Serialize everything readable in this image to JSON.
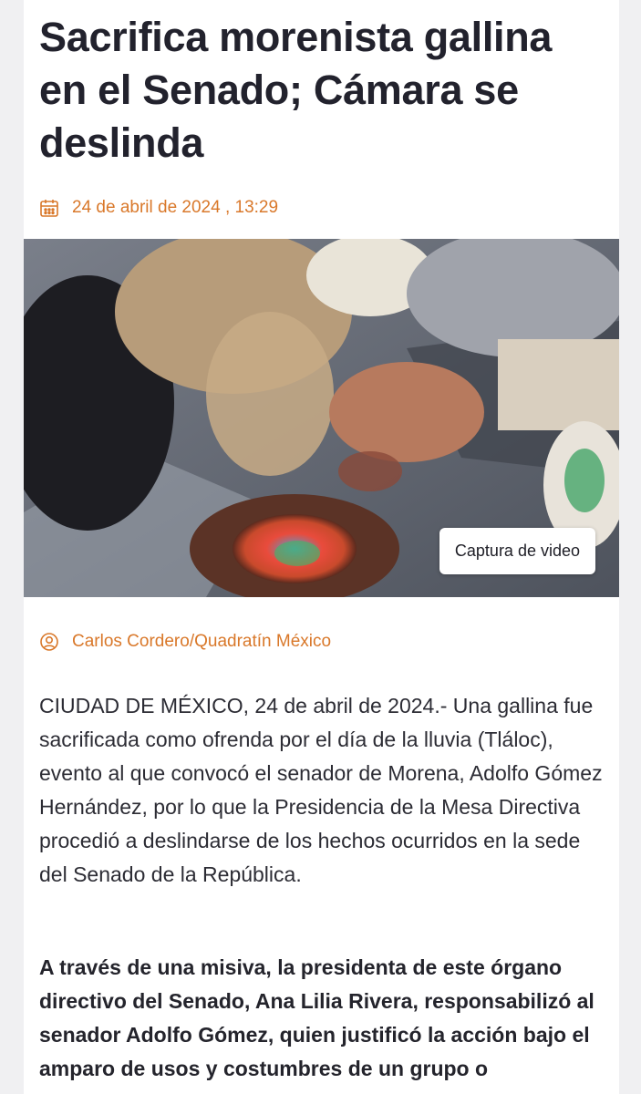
{
  "article": {
    "headline": "Sacrifica morenista gallina en el Senado; Cámara se deslinda",
    "date": "24 de abril de 2024 , 13:29",
    "date_icon": "calendar-icon",
    "media": {
      "caption": "Captura de video"
    },
    "author": "Carlos Cordero/Quadratín México",
    "author_icon": "user-icon",
    "paragraphs": [
      "CIUDAD DE MÉXICO, 24 de abril de 2024.- Una gallina fue sacrificada como ofrenda por el día de la lluvia (Tláloc), evento al que convocó el senador de Morena, Adolfo Gómez Hernández, por lo que la Presidencia de la Mesa Directiva procedió a deslindarse de los hechos ocurridos en la sede del Senado de la República.",
      "A través de una misiva, la presidenta de este órgano directivo del Senado, Ana Lilia Rivera, responsabilizó al senador Adolfo Gómez, quien justificó la acción bajo el amparo de usos y costumbres de un grupo o"
    ]
  },
  "colors": {
    "accent": "#d9782a",
    "headline": "#22222d",
    "body": "#2c2c34"
  }
}
